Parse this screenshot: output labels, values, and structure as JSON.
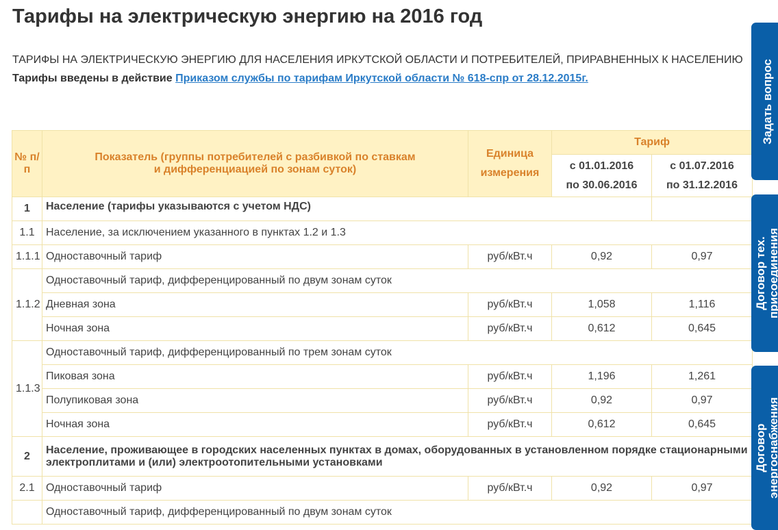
{
  "page": {
    "title": "Тарифы на электрическую энергию на 2016 год",
    "subtitle": "ТАРИФЫ НА ЭЛЕКТРИЧЕСКУЮ ЭНЕРГИЮ ДЛЯ НАСЕЛЕНИЯ ИРКУТСКОЙ ОБЛАСТИ И ПОТРЕБИТЕЛЕЙ, ПРИРАВНЕННЫХ К НАСЕЛЕНИЮ",
    "decree_prefix": "Тарифы введены в действие",
    "decree_link": "Приказом службы по тарифам Иркутской области № 618-спр от 28.12.2015г."
  },
  "table": {
    "headers": {
      "num": "№ п/п",
      "indicator_line1": "Показатель (группы потребителей с разбивкой по ставкам",
      "indicator_line2": "и дифференциацией по зонам суток)",
      "unit": "Единица измерения",
      "tariff": "Тариф",
      "period1_line1": "с 01.01.2016",
      "period1_line2": "по 30.06.2016",
      "period2_line1": "с 01.07.2016",
      "period2_line2": "по 31.12.2016"
    },
    "rows": {
      "r1": {
        "num": "1",
        "name": "Население (тарифы указываются с учетом НДС)"
      },
      "r11": {
        "num": "1.1",
        "name": "Население, за исключением указанного в пунктах 1.2 и 1.3"
      },
      "r111": {
        "num": "1.1.1",
        "name": "Одноставочный тариф",
        "unit": "руб/кВт.ч",
        "v1": "0,92",
        "v2": "0,97"
      },
      "r112": {
        "num": "1.1.2",
        "name": "Одноставочный тариф, дифференцированный по двум зонам суток"
      },
      "r112a": {
        "name": "Дневная зона",
        "unit": "руб/кВт.ч",
        "v1": "1,058",
        "v2": "1,116"
      },
      "r112b": {
        "name": "Ночная зона",
        "unit": "руб/кВт.ч",
        "v1": "0,612",
        "v2": "0,645"
      },
      "r113": {
        "num": "1.1.3",
        "name": "Одноставочный тариф, дифференцированный по трем зонам суток"
      },
      "r113a": {
        "name": "Пиковая зона",
        "unit": "руб/кВт.ч",
        "v1": "1,196",
        "v2": "1,261"
      },
      "r113b": {
        "name": "Полупиковая зона",
        "unit": "руб/кВт.ч",
        "v1": "0,92",
        "v2": "0,97"
      },
      "r113c": {
        "name": "Ночная зона",
        "unit": "руб/кВт.ч",
        "v1": "0,612",
        "v2": "0,645"
      },
      "r2": {
        "num": "2",
        "name": "Население, проживающее в городских населенных пунктах в домах, оборудованных в установленном порядке стационарными электроплитами и (или) электроотопительными установками"
      },
      "r21": {
        "num": "2.1",
        "name": "Одноставочный тариф",
        "unit": "руб/кВт.ч",
        "v1": "0,92",
        "v2": "0,97"
      },
      "r22": {
        "name": "Одноставочный тариф, дифференцированный по двум зонам суток"
      }
    }
  },
  "side_tabs": {
    "ask": "Задать вопрос",
    "contract_line1": "Договор тех.",
    "contract_line2": "присоединения",
    "supply_line1": "Договор",
    "supply_line2": "энергоснабжения"
  },
  "colors": {
    "header_bg": "#fff2c4",
    "header_text": "#d9822b",
    "border": "#f0e2a8",
    "link": "#2a7cc7",
    "tab_bg": "#0a5fa8"
  }
}
